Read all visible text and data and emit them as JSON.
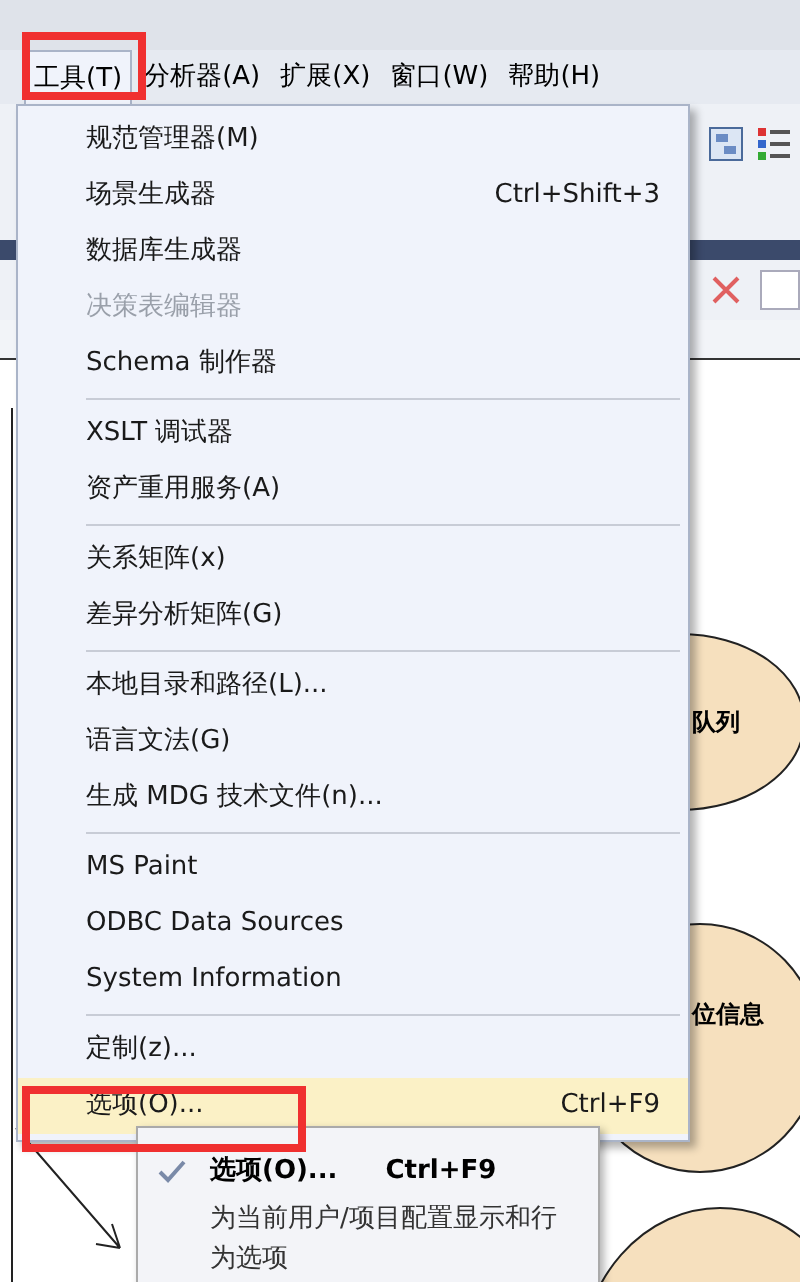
{
  "menubar": [
    {
      "label": "工具(T)",
      "selected": true
    },
    {
      "label": "分析器(A)",
      "selected": false
    },
    {
      "label": "扩展(X)",
      "selected": false
    },
    {
      "label": "窗口(W)",
      "selected": false
    },
    {
      "label": "帮助(H)",
      "selected": false
    }
  ],
  "menu": {
    "sections": [
      [
        {
          "label": "规范管理器(M)",
          "disabled": false,
          "selected": false
        },
        {
          "label": "场景生成器",
          "shortcut": "Ctrl+Shift+3",
          "disabled": false,
          "selected": false
        },
        {
          "label": "数据库生成器",
          "disabled": false,
          "selected": false
        },
        {
          "label": "决策表编辑器",
          "disabled": true,
          "selected": false
        },
        {
          "label": "Schema 制作器",
          "disabled": false,
          "selected": false
        }
      ],
      [
        {
          "label": "XSLT 调试器",
          "disabled": false,
          "selected": false
        },
        {
          "label": "资产重用服务(A)",
          "disabled": false,
          "selected": false
        }
      ],
      [
        {
          "label": "关系矩阵(x)",
          "disabled": false,
          "selected": false
        },
        {
          "label": "差异分析矩阵(G)",
          "disabled": false,
          "selected": false
        }
      ],
      [
        {
          "label": "本地目录和路径(L)...",
          "disabled": false,
          "selected": false
        },
        {
          "label": "语言文法(G)",
          "disabled": false,
          "selected": false
        },
        {
          "label": "生成 MDG 技术文件(n)...",
          "disabled": false,
          "selected": false
        }
      ],
      [
        {
          "label": "MS Paint",
          "disabled": false,
          "selected": false
        },
        {
          "label": "ODBC Data Sources",
          "disabled": false,
          "selected": false
        },
        {
          "label": "System Information",
          "disabled": false,
          "selected": false
        }
      ],
      [
        {
          "label": "定制(z)...",
          "disabled": false,
          "selected": false
        },
        {
          "label": "选项(O)...",
          "shortcut": "Ctrl+F9",
          "disabled": false,
          "selected": true
        }
      ]
    ]
  },
  "tooltip": {
    "title": "选项(O)...",
    "shortcut": "Ctrl+F9",
    "description": "为当前用户/项目配置显示和行为选项"
  },
  "diagram": {
    "nodes": [
      {
        "label": "队列"
      },
      {
        "label": "位信息"
      }
    ]
  }
}
